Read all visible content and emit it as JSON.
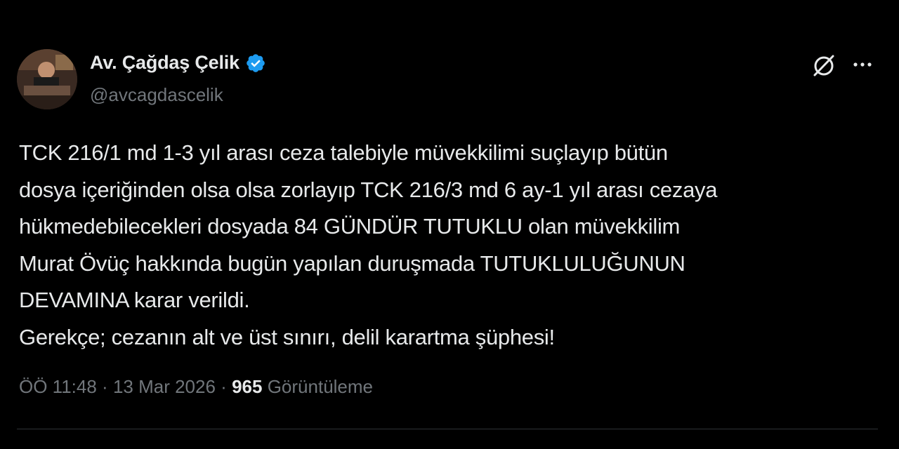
{
  "tweet": {
    "display_name": "Av. Çağdaş Çelik",
    "handle": "@avcagdascelik",
    "body_lines": [
      "TCK 216/1 md 1-3 yıl arası ceza talebiyle müvekkilimi suçlayıp bütün",
      "dosya içeriğinden olsa olsa zorlayıp TCK 216/3 md 6 ay-1 yıl arası cezaya",
      "hükmedebilecekleri dosyada 84 GÜNDÜR TUTUKLU olan müvekkilim",
      "Murat Övüç hakkında bugün yapılan duruşmada TUTUKLULUĞUNUN",
      "DEVAMINA karar verildi.",
      "Gerekçe; cezanın alt ve üst sınırı, delil karartma şüphesi!"
    ],
    "time": "ÖÖ 11:48",
    "date": "13 Mar 2026",
    "separator": "·",
    "views_count": "965",
    "views_label": "Görüntüleme"
  },
  "icons": {
    "verified": "verified-badge-icon",
    "grok": "grok-icon",
    "more": "more-options-icon"
  },
  "colors": {
    "background": "#000000",
    "text": "#e7e9ea",
    "muted": "#71767b",
    "verified": "#1d9bf0",
    "divider": "#2f3336"
  }
}
